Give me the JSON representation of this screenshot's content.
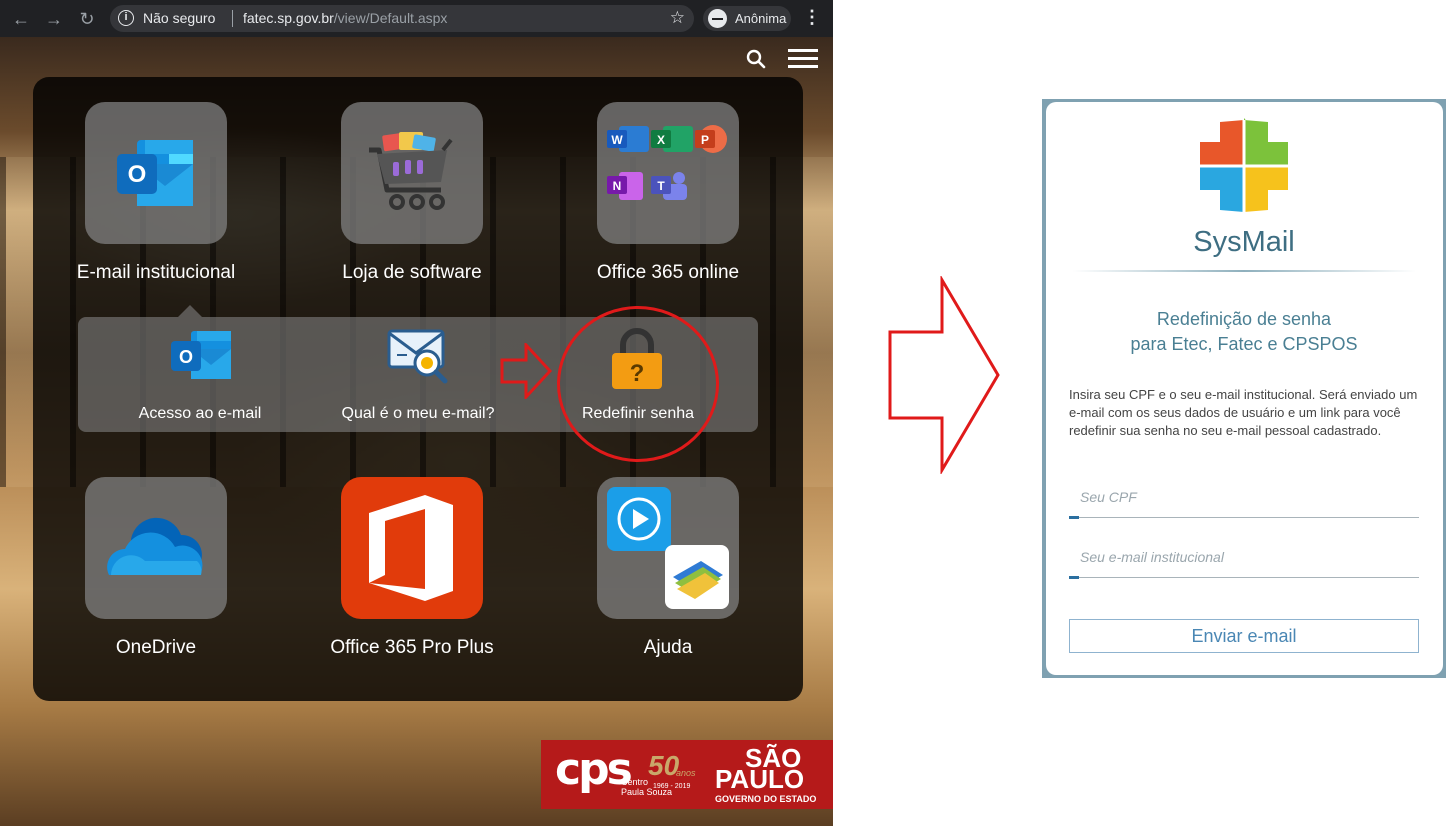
{
  "browser": {
    "insecure_label": "Não seguro",
    "url_domain": "fatec.sp.gov.br",
    "url_path": "/view/Default.aspx",
    "incognito_label": "Anônima"
  },
  "apps": {
    "email": "E-mail institucional",
    "store": "Loja de software",
    "office_online": "Office 365 online",
    "onedrive": "OneDrive",
    "office_pro": "Office 365 Pro Plus",
    "help": "Ajuda"
  },
  "subapps": {
    "access": "Acesso ao e-mail",
    "which": "Qual é o meu e-mail?",
    "reset": "Redefinir senha"
  },
  "office_letters": {
    "word": "W",
    "excel": "X",
    "powerpoint": "P",
    "onenote": "N",
    "teams": "T",
    "outlook": "O"
  },
  "logo": {
    "cps": "cps",
    "cps_sub": "Centro\nPaula Souza",
    "fifty": "50",
    "anos": "anos",
    "years": "1969 - 2019",
    "sp1": "SÃO",
    "sp2": "PAULO",
    "sp3": "GOVERNO DO ESTADO"
  },
  "sysmail": {
    "title": "SysMail",
    "heading_line1": "Redefinição de senha",
    "heading_line2": "para Etec, Fatec e CPSPOS",
    "description": "Insira seu CPF e o seu e-mail institucional. Será enviado um e-mail com os seus dados de usuário e um link para você redefinir sua senha no seu e-mail pessoal cadastrado.",
    "cpf_placeholder": "Seu CPF",
    "email_placeholder": "Seu e-mail institucional",
    "send_label": "Enviar e-mail"
  },
  "colors": {
    "arrow_red": "#e01a1a",
    "sysmail_accent": "#3e6e82",
    "office_red": "#e13b0b",
    "outlook_blue": "#0f6cbd"
  }
}
